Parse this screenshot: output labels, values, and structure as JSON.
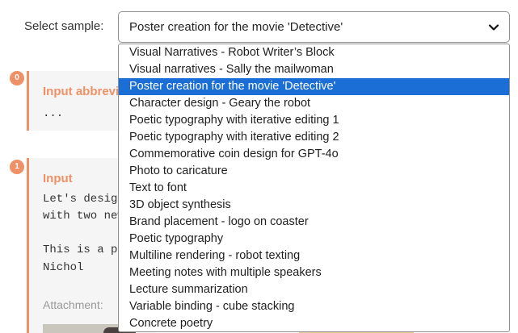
{
  "select": {
    "label": "Select sample:",
    "value": "Poster creation for the movie 'Detective'",
    "icon": "chevron-down-icon"
  },
  "cards": [
    {
      "index": "0",
      "heading": "Input abbreviated",
      "body": "..."
    },
    {
      "index": "1",
      "heading": "Input",
      "lines": [
        "Let's design",
        "with two new",
        "",
        "This is a pi",
        "Nichol"
      ],
      "attachment_label": "Attachment:"
    }
  ],
  "dropdown": {
    "selected_index": 2,
    "selected_color": "#1b6ed6",
    "options": [
      "Visual Narratives - Robot Writer’s Block",
      "Visual narratives - Sally the mailwoman",
      "Poster creation for the movie 'Detective'",
      "Character design - Geary the robot",
      "Poetic typography with iterative editing 1",
      "Poetic typography with iterative editing 2",
      "Commemorative coin design for GPT-4o",
      "Photo to caricature",
      "Text to font",
      "3D object synthesis",
      "Brand placement - logo on coaster",
      "Poetic typography",
      "Multiline rendering - robot texting",
      "Meeting notes with multiple speakers",
      "Lecture summarization",
      "Variable binding - cube stacking",
      "Concrete poetry"
    ]
  },
  "accent_color": "#ef9166"
}
